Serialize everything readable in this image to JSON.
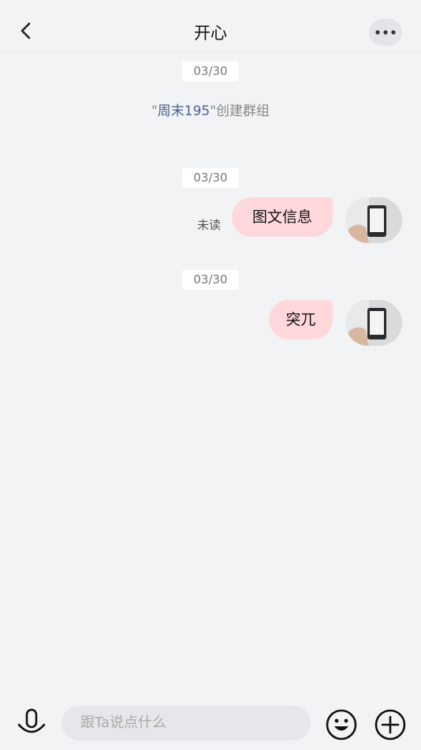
{
  "header": {
    "title": "开心",
    "back_icon": "chevron-left-icon",
    "more_icon": "more-horizontal-icon"
  },
  "messages": [
    {
      "date": "03/30",
      "system": {
        "quote_open": "\"",
        "user": "周末195",
        "quote_close": "\"",
        "action": "创建群组"
      }
    },
    {
      "date": "03/30",
      "text": "图文信息",
      "status": "未读"
    },
    {
      "date": "03/30",
      "text": "突兀"
    }
  ],
  "input": {
    "placeholder": "跟Ta说点什么"
  },
  "colors": {
    "bubble": "#ffd8dc",
    "background": "#f2f3f5",
    "highlight_user": "#4d5f8c"
  }
}
